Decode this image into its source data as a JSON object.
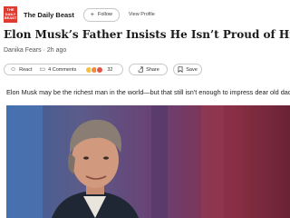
{
  "source": {
    "logo_text": [
      "THE",
      "DAILY",
      "BEAST"
    ],
    "name": "The Daily Beast",
    "follow_label": "Follow",
    "view_profile_label": "View Profile"
  },
  "article": {
    "title": "Elon Musk’s Father Insists He Isn’t Proud of Him",
    "author": "Danika Fears",
    "time_ago": "2h ago",
    "lede": "Elon Musk may be the richest man in the world—but that still isn't enough to impress dear old dad."
  },
  "actions": {
    "react_label": "React",
    "comments_label": "4 Comments",
    "reaction_count": "32",
    "share_label": "Share",
    "save_label": "Save"
  },
  "colors": {
    "brand": "#e03a2f",
    "reaction_emojis": [
      "#f5c33b",
      "#f08a3c",
      "#e2554a"
    ]
  }
}
